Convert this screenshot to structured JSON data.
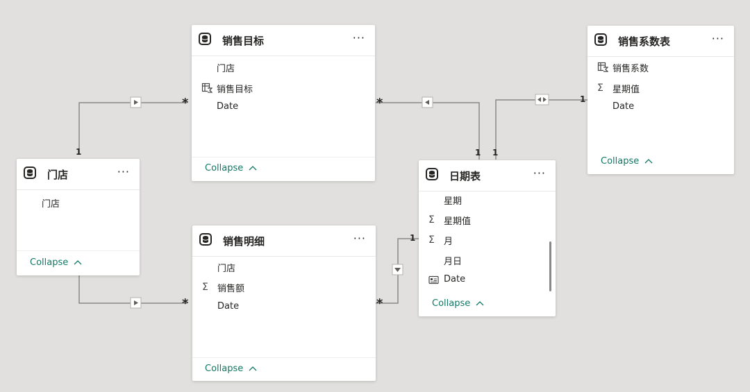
{
  "tables": {
    "sales_target": {
      "title": "销售目标",
      "fields": [
        {
          "icon": "none",
          "name": "门店"
        },
        {
          "icon": "measure-table-icon",
          "name": "销售目标"
        },
        {
          "icon": "none",
          "name": "Date"
        }
      ],
      "collapse_label": "Collapse"
    },
    "store": {
      "title": "门店",
      "fields": [
        {
          "icon": "none",
          "name": "门店"
        }
      ],
      "collapse_label": "Collapse"
    },
    "sales_detail": {
      "title": "销售明细",
      "fields": [
        {
          "icon": "none",
          "name": "门店"
        },
        {
          "icon": "sum-icon",
          "name": "销售额"
        },
        {
          "icon": "none",
          "name": "Date"
        }
      ],
      "collapse_label": "Collapse"
    },
    "date_table": {
      "title": "日期表",
      "fields": [
        {
          "icon": "none",
          "name": "星期"
        },
        {
          "icon": "sum-icon",
          "name": "星期值"
        },
        {
          "icon": "sum-icon",
          "name": "月"
        },
        {
          "icon": "none",
          "name": "月日"
        },
        {
          "icon": "calendar-icon",
          "name": "Date"
        }
      ],
      "collapse_label": "Collapse"
    },
    "sales_coef": {
      "title": "销售系数表",
      "fields": [
        {
          "icon": "measure-table-icon",
          "name": "销售系数"
        },
        {
          "icon": "sum-icon",
          "name": "星期值"
        },
        {
          "icon": "none",
          "name": "Date"
        }
      ],
      "collapse_label": "Collapse"
    }
  },
  "cardinality": {
    "one": "1",
    "many": "*"
  },
  "more_label": "···",
  "chevron_up": "^",
  "colors": {
    "line": "#8a8886",
    "collapse": "#117865",
    "background": "#e1e0df"
  }
}
